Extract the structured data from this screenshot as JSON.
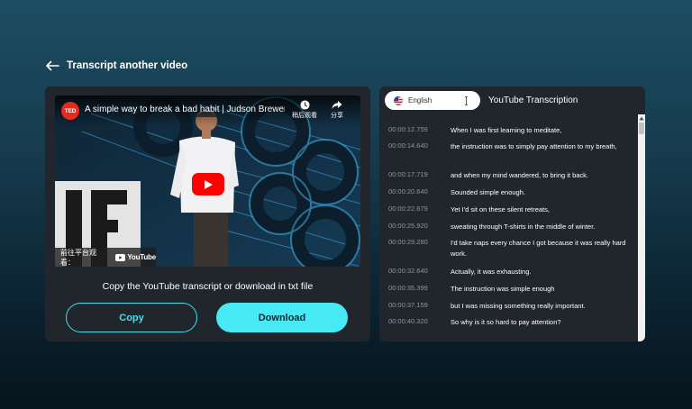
{
  "back": {
    "label": "Transcript another video",
    "icon": "arrow-left-icon"
  },
  "video": {
    "channel_logo": "TED",
    "title": "A simple way to break a bad habit | Judson Brewer | ...",
    "watch_later": "稍后观看",
    "share": "分享",
    "watch_on": "前往平台观看：",
    "platform": "YouTube"
  },
  "actions": {
    "caption": "Copy the YouTube transcript or download in txt file",
    "copy": "Copy",
    "download": "Download"
  },
  "transcript": {
    "language": "English",
    "title": "YouTube Transcription",
    "rows": [
      {
        "time": "00:00:12.759",
        "text": "When I was first learning to meditate,"
      },
      {
        "time": "00:00:14.640",
        "text": "the instruction was to simply pay attention to my breath,"
      },
      {
        "time": "00:00:17.719",
        "text": "and when my mind wandered, to bring it back."
      },
      {
        "time": "00:00:20.640",
        "text": "Sounded simple enough."
      },
      {
        "time": "00:00:22.679",
        "text": "Yet I'd sit on these silent retreats,"
      },
      {
        "time": "00:00:25.920",
        "text": "sweating through T-shirts in the middle of winter."
      },
      {
        "time": "00:00:29.280",
        "text": "I'd take naps every chance I got because it was really hard work."
      },
      {
        "time": "00:00:32.640",
        "text": "Actually, it was exhausting."
      },
      {
        "time": "00:00:35.399",
        "text": "The instruction was simple enough"
      },
      {
        "time": "00:00:37.159",
        "text": "but I was missing something really important."
      },
      {
        "time": "00:00:40.320",
        "text": "So why is it so hard to pay attention?"
      }
    ]
  },
  "colors": {
    "accent": "#46e9f4",
    "panel": "#20262c",
    "youtube_red": "#ff0000",
    "ted_red": "#e62b1e"
  }
}
